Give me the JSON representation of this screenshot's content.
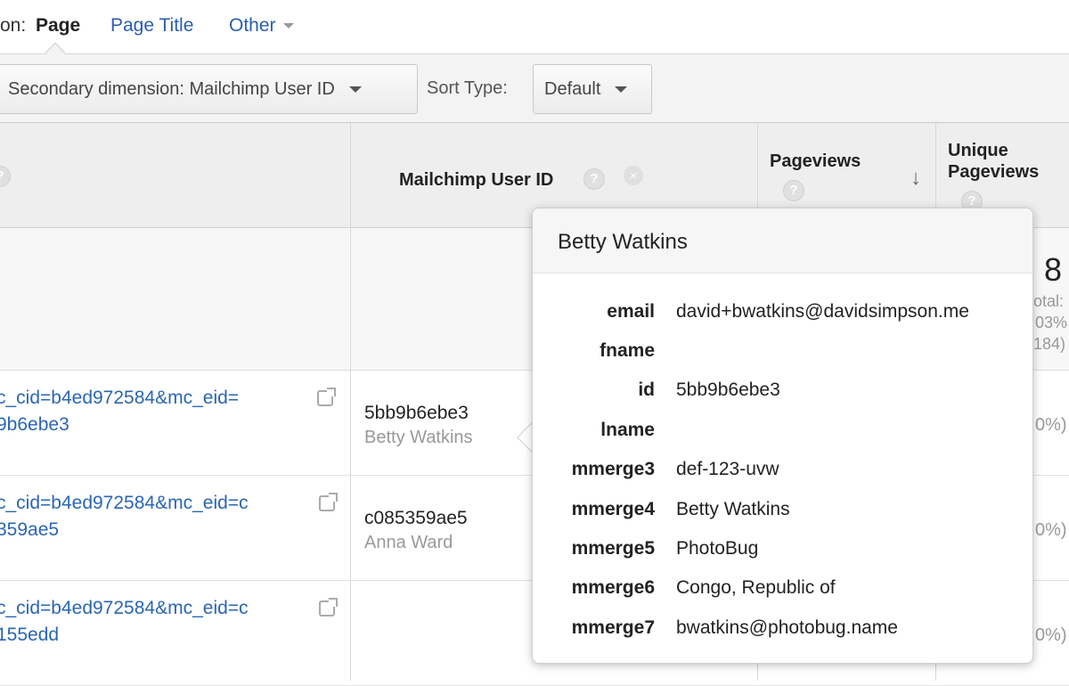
{
  "primary_dimension": {
    "label": "on:",
    "options": [
      {
        "label": "Page",
        "active": true
      },
      {
        "label": "Page Title",
        "active": false
      },
      {
        "label": "Other",
        "active": false
      }
    ]
  },
  "toolbar": {
    "secondary_dimension": "Secondary dimension: Mailchimp User ID",
    "sort_type_label": "Sort Type:",
    "sort_type_value": "Default"
  },
  "table": {
    "headers": {
      "mailchimp_user_id": "Mailchimp User ID",
      "pageviews": "Pageviews",
      "unique_pageviews_line1": "Unique",
      "unique_pageviews_line2": "Pageviews",
      "help": "?"
    },
    "totals": {
      "value": "8",
      "label": "otal:",
      "pct": "03%",
      "paren": "184)"
    },
    "rows": [
      {
        "page_line1": "c_cid=b4ed972584&mc_eid=",
        "page_line2": "9b6ebe3",
        "user_id": "5bb9b6ebe3",
        "user_name": "Betty Watkins",
        "pct": "0%)"
      },
      {
        "page_line1": "c_cid=b4ed972584&mc_eid=c",
        "page_line2": "359ae5",
        "user_id": "c085359ae5",
        "user_name": "Anna Ward",
        "pct": "0%)"
      },
      {
        "page_line1": "c_cid=b4ed972584&mc_eid=c",
        "page_line2": "155edd",
        "user_id": "",
        "user_name": "",
        "pct": "0%)"
      }
    ]
  },
  "popup": {
    "title": "Betty Watkins",
    "fields": [
      {
        "key": "email",
        "value": "david+bwatkins@davidsimpson.me"
      },
      {
        "key": "fname",
        "value": ""
      },
      {
        "key": "id",
        "value": "5bb9b6ebe3"
      },
      {
        "key": "lname",
        "value": ""
      },
      {
        "key": "mmerge3",
        "value": "def-123-uvw"
      },
      {
        "key": "mmerge4",
        "value": "Betty Watkins"
      },
      {
        "key": "mmerge5",
        "value": "PhotoBug"
      },
      {
        "key": "mmerge6",
        "value": "Congo, Republic of"
      },
      {
        "key": "mmerge7",
        "value": "bwatkins@photobug.name"
      }
    ]
  },
  "colors": {
    "link": "#2a66b3",
    "header_bg": "#eeeeee",
    "toolbar_bg": "#f3f3f3"
  }
}
